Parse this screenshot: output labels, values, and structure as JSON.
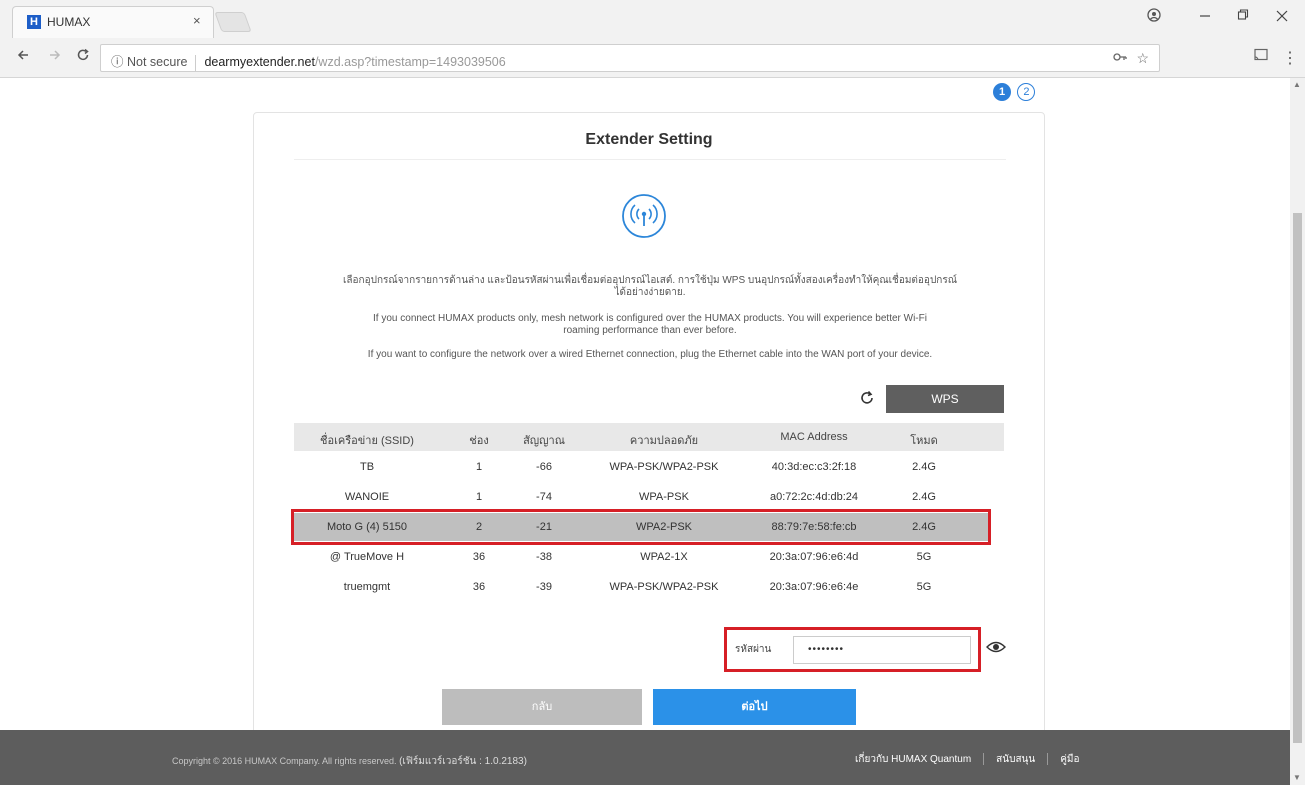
{
  "browser": {
    "tab_title": "HUMAX",
    "tab_favicon": "H",
    "tab_close": "×",
    "security_label": "Not secure",
    "url_host": "dearmyextender.net",
    "url_path": "/wzd.asp?timestamp=1493039506"
  },
  "steps": [
    "1",
    "2"
  ],
  "card": {
    "title": "Extender Setting",
    "desc_thai_line1": "เลือกอุปกรณ์จากรายการด้านล่าง และป้อนรหัสผ่านเพื่อเชื่อมต่ออุปกรณ์ไอเสต์. การใช้ปุ่ม WPS บนอุปกรณ์ทั้งสองเครื่องทำให้คุณเชื่อมต่ออุปกรณ์",
    "desc_thai_line2": "ได้อย่างง่ายดาย.",
    "desc_mesh_line1": "If you connect HUMAX products only, mesh network is configured over the HUMAX products. You will experience better Wi-Fi",
    "desc_mesh_line2": "roaming performance than ever before.",
    "desc_wired": "If you want to configure the network over a wired Ethernet connection, plug the Ethernet cable into the WAN port of your device.",
    "wps_label": "WPS"
  },
  "table": {
    "headers": [
      "ชื่อเครือข่าย (SSID)",
      "ช่อง",
      "สัญญาณ",
      "ความปลอดภัย",
      "MAC Address",
      "โหมด"
    ],
    "rows": [
      {
        "ssid": "TB",
        "channel": "1",
        "signal": "-66",
        "security": "WPA-PSK/WPA2-PSK",
        "mac": "40:3d:ec:c3:2f:18",
        "mode": "2.4G"
      },
      {
        "ssid": "WANOIE",
        "channel": "1",
        "signal": "-74",
        "security": "WPA-PSK",
        "mac": "a0:72:2c:4d:db:24",
        "mode": "2.4G"
      },
      {
        "ssid": "Moto G (4) 5150",
        "channel": "2",
        "signal": "-21",
        "security": "WPA2-PSK",
        "mac": "88:79:7e:58:fe:cb",
        "mode": "2.4G"
      },
      {
        "ssid": "@ TrueMove H",
        "channel": "36",
        "signal": "-38",
        "security": "WPA2-1X",
        "mac": "20:3a:07:96:e6:4d",
        "mode": "5G"
      },
      {
        "ssid": "truemgmt",
        "channel": "36",
        "signal": "-39",
        "security": "WPA-PSK/WPA2-PSK",
        "mac": "20:3a:07:96:e6:4e",
        "mode": "5G"
      }
    ]
  },
  "password": {
    "label": "รหัสผ่าน",
    "value": "••••••••"
  },
  "buttons": {
    "back": "กลับ",
    "next": "ต่อไป"
  },
  "footer": {
    "copyright": "Copyright © 2016 HUMAX Company. All rights reserved.",
    "version": "(เฟิร์มแวร์เวอร์ชัน : 1.0.2183)",
    "link_about": "เกี่ยวกับ HUMAX Quantum",
    "link_support": "สนับสนุน",
    "link_manual": "คู่มือ"
  }
}
